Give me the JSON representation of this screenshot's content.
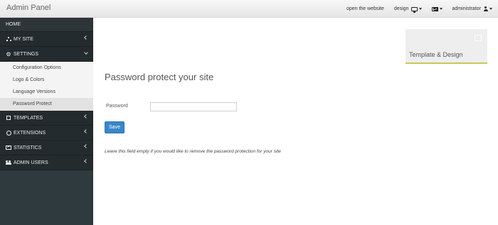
{
  "header": {
    "brand": "Admin Panel",
    "open_website": "open the website",
    "design": "design",
    "user": "administrator"
  },
  "sidebar": {
    "items": [
      {
        "label": "HOME",
        "icon": ""
      },
      {
        "label": "MY SITE",
        "icon": "sitemap-icon"
      },
      {
        "label": "SETTINGS",
        "icon": "gears-icon",
        "expanded": true
      },
      {
        "label": "TEMPLATES",
        "icon": "square-icon"
      },
      {
        "label": "EXTENSIONS",
        "icon": "circle-icon"
      },
      {
        "label": "STATISTICS",
        "icon": "chart-icon"
      },
      {
        "label": "ADMIN USERS",
        "icon": "users-icon"
      }
    ],
    "settings_sub": [
      {
        "label": "Configuration Options"
      },
      {
        "label": "Logo & Colors"
      },
      {
        "label": "Language Versions"
      },
      {
        "label": "Password Protect",
        "active": true
      }
    ]
  },
  "tile": {
    "label": "Template & Design"
  },
  "main": {
    "title": "Password protect your site",
    "password_label": "Password",
    "password_value": "",
    "save_label": "Save",
    "help": "Leave this field empty if you would like to remove the password protection for your site"
  },
  "colors": {
    "sidebar": "#2f3a3f",
    "accent": "#3a86c8",
    "tile_border": "#c8c85a"
  }
}
